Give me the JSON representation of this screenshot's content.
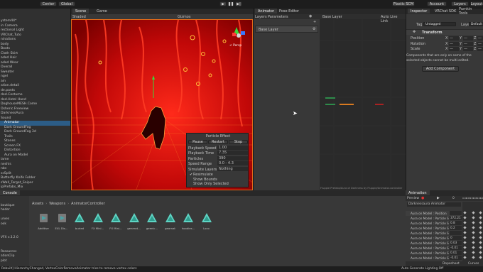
{
  "toolbar": {
    "center_label": "Center",
    "global_label": "Global",
    "plastic_label": "Plastic SCM",
    "account_label": "Account",
    "layers_label": "Layers",
    "layout_label": "Layout"
  },
  "hierarchy": {
    "items": [
      "ystem44*",
      "in Camera",
      "rectional Light",
      "VRChat_Tuto",
      "ninations",
      "body",
      "Boots",
      "Cloth Skirt",
      "aded Hair",
      "aded Wear",
      "Overall",
      "Sweater",
      "ngel",
      "ain",
      "ation.detail",
      "de.pants",
      "ded.Costume",
      "ded.Hotel Hand",
      "DoghouseMESH.Come",
      "Osheric.Freeview",
      "DarknessAura",
      "Sound",
      "Animator",
      "Dark GroundFog",
      "Dark GroundFog 3d",
      "Trails",
      "Stones",
      "Screen FX",
      "Distortion",
      "Aura on Model",
      "lame",
      "neshis",
      "nbs",
      "ssSplit",
      "Butterfly Knife Folder",
      "sWall_Target_Sniper",
      "ipPrefabs_Mix"
    ]
  },
  "scene": {
    "tab_scene": "Scene",
    "tab_game": "Game",
    "shading": "Shaded",
    "gizmos": "Gizmos",
    "persp": "< Persp"
  },
  "particle_effect": {
    "title": "Particle Effect",
    "pause": "Pause",
    "restart": "Restart",
    "stop": "Stop",
    "rows": [
      {
        "label": "Playback Speed",
        "value": "1.00"
      },
      {
        "label": "Playback Time",
        "value": "7.35"
      },
      {
        "label": "Particles",
        "value": "390"
      },
      {
        "label": "Speed Range",
        "value": "0.0 - 4.3"
      },
      {
        "label": "Simulate Layers",
        "value": "Nothing"
      }
    ],
    "options": [
      "Resimulate",
      "Show Bounds",
      "Show Only Selected"
    ]
  },
  "animator": {
    "tab": "Animator",
    "tab_pose": "Pose Editor",
    "layers_tab": "Layers",
    "parameters_tab": "Parameters",
    "base_layer": "Base Layer",
    "breadcrumb": "Base Layer",
    "auto_live_link": "Auto Live Link",
    "footer": "Fluppie Prefabs/Aura of Darkness by Fluppie/Animator.controller"
  },
  "inspector": {
    "tab": "Inspector",
    "tab_vrchat": "VRChat SDK",
    "tab_pumkin": "Pumkin Tools",
    "tag_label": "Tag",
    "tag_value": "Untagged",
    "layer_label": "Layer",
    "layer_value": "Default",
    "transform": "Transform",
    "position": "Position",
    "rotation": "Rotation",
    "scale": "Scale",
    "x": "X",
    "y": "Y",
    "z": "Z",
    "dash": "—",
    "note": "Components that are only on some of the selected objects cannot be multi-edited.",
    "add_component": "Add Component"
  },
  "console": {
    "tab": "Console",
    "breadcrumb": [
      "Assets",
      "Weapons",
      "AnimatorController"
    ],
    "side_items": [
      "",
      "boutique",
      "hader",
      "",
      "urves",
      "ook",
      "",
      "",
      "VFX v.3.2.0",
      "",
      "",
      "Resources",
      "ationClip",
      "plot"
    ],
    "assets": [
      "Additive",
      "EXL Dis...",
      "burled",
      "FX Mini...",
      "FX Mini...",
      "generat...",
      "geenic...",
      "gearnat",
      "hoodies...",
      "Loco"
    ],
    "status": "Rebuilt] HierarchyChanged, VertexColorRemoveAnimator tries to remove vertex colors",
    "status_right": "Auto Generate Lighting Off"
  },
  "animation": {
    "tab": "Animation",
    "preview": "Preview",
    "frame": "0",
    "clip": "Darknessaura Animator",
    "ruler": [
      "0:00",
      "0:15",
      "0:30",
      "0:45",
      "1:00",
      "1:15"
    ],
    "props": [
      {
        "name": "Aura on Model : Position",
        "value": ""
      },
      {
        "name": "Aura on Model : Particle S",
        "value": "372.21"
      },
      {
        "name": "Aura on Model : Particle S",
        "value": "0.8"
      },
      {
        "name": "Aura on Model : Particle S",
        "value": "0.2"
      },
      {
        "name": "Aura on Model : Particle S",
        "value": ""
      },
      {
        "name": "Aura on Model : Particle S",
        "value": "0"
      },
      {
        "name": "Aura on Model : Particle S",
        "value": "0.03"
      },
      {
        "name": "Aura on Model : Particle S",
        "value": "-0.01"
      },
      {
        "name": "Aura on Model : Particle S",
        "value": "0.01"
      },
      {
        "name": "Aura on Model : Particle S",
        "value": "-0.01"
      }
    ],
    "dopesheet": "Dopesheet",
    "curves": "Curves"
  },
  "colors": {
    "accent": "#3a79bb",
    "scene_red": "#d81010",
    "select_blue": "#2c5d87"
  }
}
